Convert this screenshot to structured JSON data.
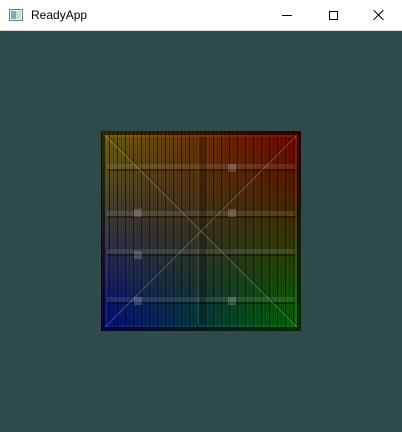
{
  "window": {
    "title": "ReadyApp",
    "background": "#2f4a4a"
  },
  "controls": {
    "minimize_icon": "minimize-icon",
    "maximize_icon": "maximize-icon",
    "close_icon": "close-icon"
  },
  "scene": {
    "object": "crate",
    "texture": "wood-planks",
    "vertex_colors": {
      "top_left": "#c6b000",
      "top_right": "#d10000",
      "bottom_left": "#0010e8",
      "bottom_right": "#00c000"
    }
  }
}
